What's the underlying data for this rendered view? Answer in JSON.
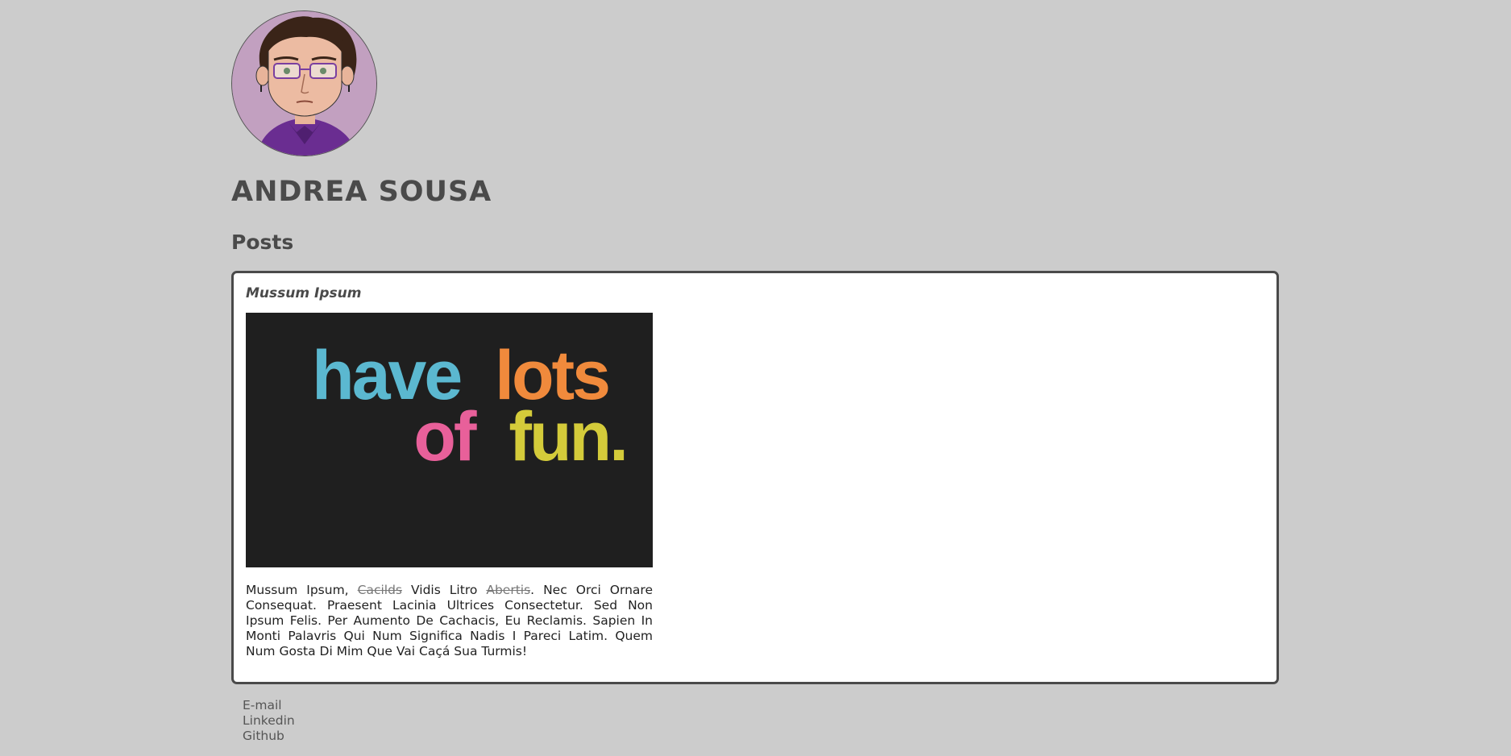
{
  "profile": {
    "name": "ANDREA SOUSA",
    "avatar_icon": "cartoon-avatar-icon"
  },
  "posts_section": {
    "title": "Posts"
  },
  "post": {
    "title": "Mussum Ipsum",
    "image_line1_words": [
      "have",
      "lots"
    ],
    "image_line2_words": [
      "of",
      "fun."
    ],
    "body": {
      "part1": "Mussum Ipsum, ",
      "strike1": "Cacilds",
      "part2": " Vidis Litro ",
      "strike2": "Abertis",
      "part3": ". Nec Orci Ornare Consequat. Praesent Lacinia Ultrices Consectetur. Sed Non Ipsum Felis. Per Aumento De Cachacis, Eu Reclamis. Sapien In Monti Palavris Qui Num Significa Nadis I Pareci Latim. Quem Num Gosta Di Mim Que Vai Caçá Sua Turmis!"
    }
  },
  "footer_links": {
    "email": "E-mail",
    "linkedin": "Linkedin",
    "github": "Github"
  },
  "colors": {
    "background": "#cccccc",
    "card_border": "#4a4a4a",
    "image_bg": "#1f1f1f"
  }
}
